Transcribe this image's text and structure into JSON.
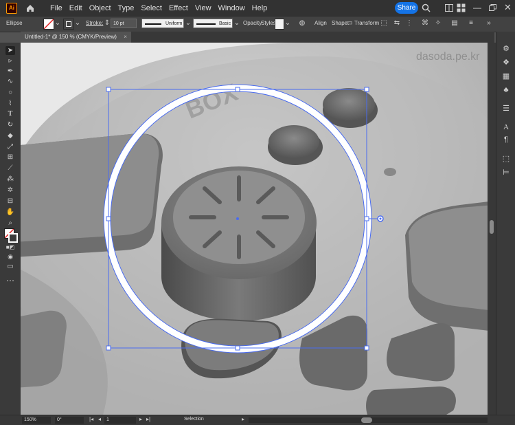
{
  "menubar": {
    "logo": "Ai",
    "menus": [
      "File",
      "Edit",
      "Object",
      "Type",
      "Select",
      "Effect",
      "View",
      "Window",
      "Help"
    ],
    "share_label": "Share"
  },
  "controlbar": {
    "selection_type": "Ellipse",
    "stroke_label": "Stroke:",
    "stroke_value": "10 pt",
    "profile_value": "Uniform",
    "brush_value": "Basic",
    "opacity_label": "Opacity",
    "styles_label": "Styles:",
    "align_label": "Align",
    "shape_label": "Shape:",
    "transform_label": "Transform"
  },
  "document": {
    "tab_title": "Untitled-1* @ 150 % (CMYK/Preview)",
    "close_symbol": "×"
  },
  "watermark": "dasoda.pe.kr",
  "statusbar": {
    "zoom": "150%",
    "rotation": "0°",
    "artboard": "1",
    "mode": "Selection"
  },
  "colors": {
    "selection_blue": "#4a6cf0",
    "share_blue": "#1473e6",
    "ui_dark": "#323232"
  },
  "icons": {
    "toolbar": [
      "selection-icon",
      "direct-selection-icon",
      "pen-icon",
      "curvature-icon",
      "ellipse-icon",
      "brush-icon",
      "pencil-icon",
      "type-icon",
      "rotate-icon",
      "eraser-icon",
      "scale-icon",
      "width-icon",
      "shape-builder-icon",
      "gradient-icon",
      "eyedropper-icon",
      "blend-icon",
      "symbol-sprayer-icon",
      "artboard-icon",
      "hand-icon",
      "zoom-icon"
    ],
    "rightpanel": [
      "appearance-icon",
      "layers-icon",
      "libraries-icon",
      "swatches-icon",
      "brushes-icon",
      "symbols-icon",
      "properties-icon",
      "character-icon",
      "paragraph-icon"
    ]
  }
}
